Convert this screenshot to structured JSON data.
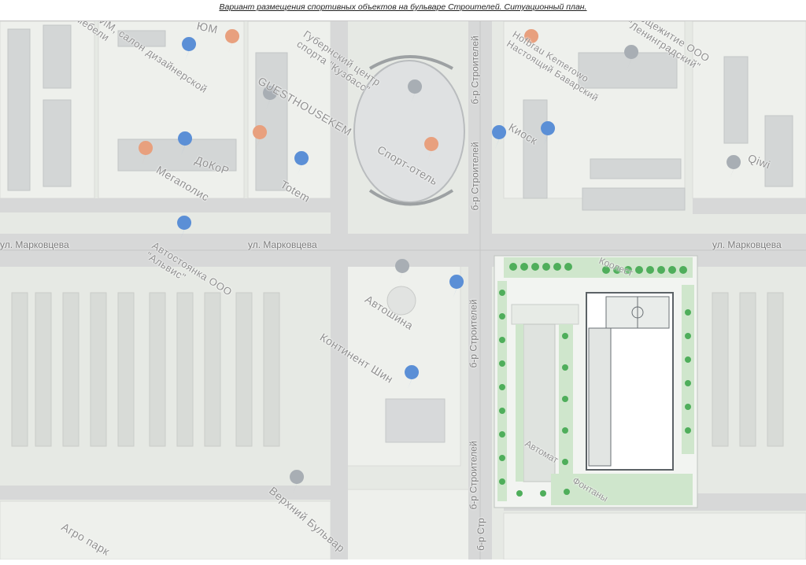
{
  "document": {
    "title": "Вариант размещения спортивных объектов на бульваре Строителей. Ситуационный план."
  },
  "colors": {
    "map_background": "#e8ebe6",
    "road": "#d6d7d7",
    "block": "#eef0ec",
    "plan_green": "#cfe6cc",
    "tree": "#4fae5b",
    "pin_orange": "#e8a07e",
    "pin_gray": "#a8aeb4",
    "pin_blue": "#5b8fd6"
  },
  "streets": {
    "markovtseva_left": "ул. Марковцева",
    "markovtseva_mid": "ул. Марковцева",
    "markovtseva_right": "ул. Марковцева",
    "builders_1": "б-р Строителей",
    "builders_2": "б-р Строителей",
    "builders_3": "б-р Строителей",
    "builders_4": "б-р Строителей",
    "builders_5": "б-р Стр"
  },
  "places": {
    "yum": "ЮМ",
    "artim": "АРТИМ, салон дизайнерской мебели",
    "gubernsky": "Губернский центр спорта \"Кузбасс\"",
    "hofbrau": "Hofbrau Kemerowo Настоящий Баварский",
    "obshchezhitie": "Общежитие ООО \"Ленинградский\"",
    "guesthouse": "GUESTHOUSEKEM",
    "kiosk": "Киоск",
    "dokor": "ДоКоР",
    "megapolis": "Мегаполис",
    "totem": "Totem",
    "sportotel": "Спорт-отель",
    "qiwi": "Qiwi",
    "avtostoyanka": "Автостоянка ООО \"Альвис\"",
    "avtoshina": "Автошина",
    "kontinent": "Континент Шин",
    "koolest": "Коолест",
    "verkhny": "Верхний Бульвар",
    "agropark": "Агро парк",
    "avtomat": "Автомат",
    "fontany": "Фонтаны"
  }
}
